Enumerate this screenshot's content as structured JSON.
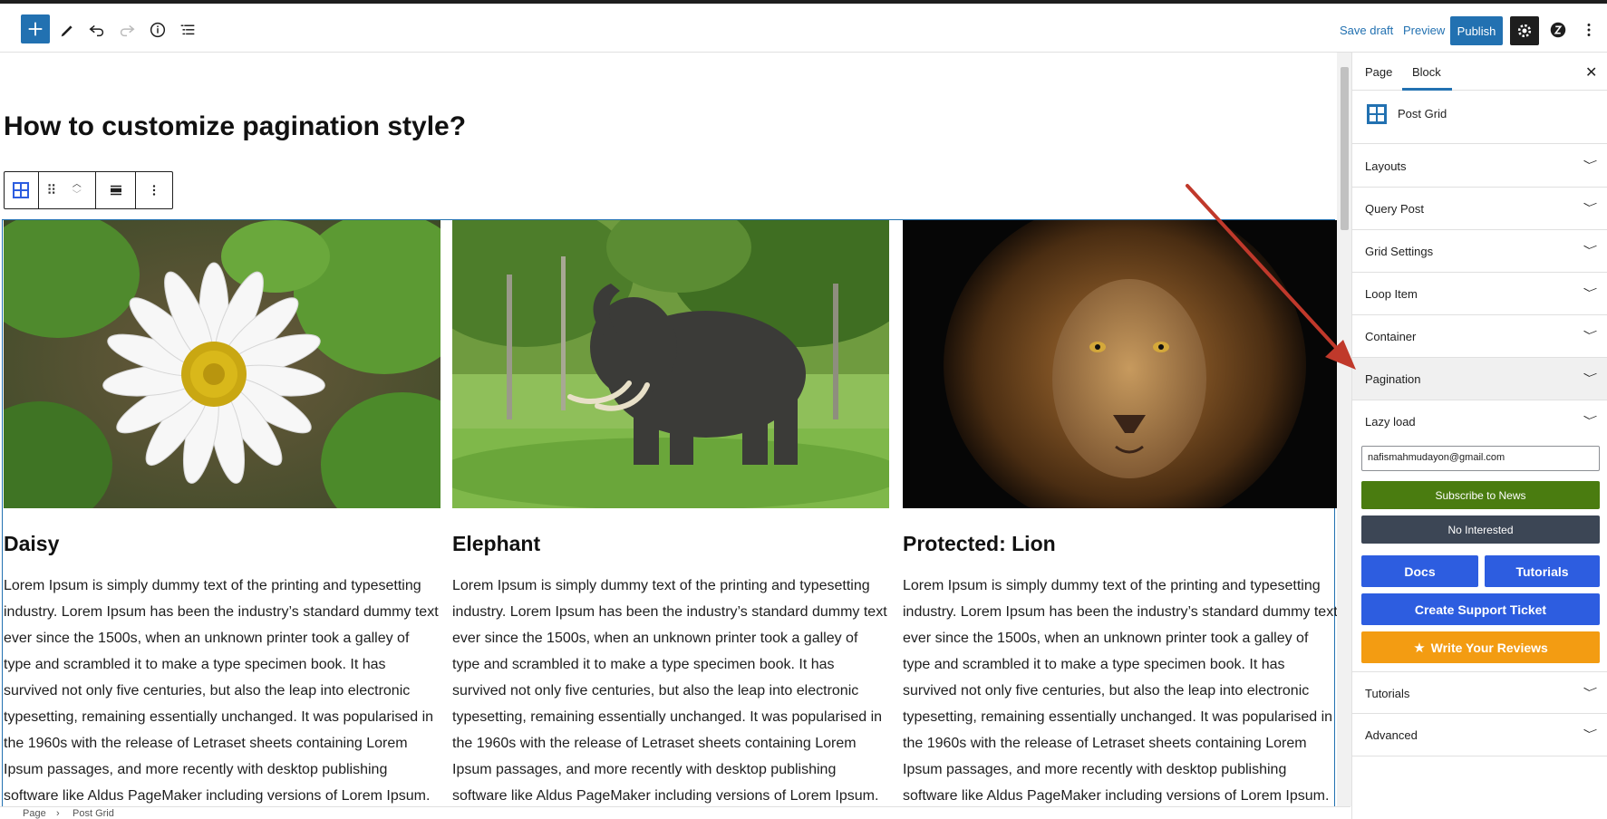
{
  "toolbar": {
    "add_icon": "plus-icon",
    "save_draft": "Save draft",
    "preview": "Preview",
    "publish": "Publish"
  },
  "editor": {
    "title": "How to customize pagination style?",
    "cards": [
      {
        "title": "Daisy",
        "text": "Lorem Ipsum is simply dummy text of the printing and typesetting industry. Lorem Ipsum has been the industry’s standard dummy text ever since the 1500s, when an unknown printer took a galley of type and scrambled it to make a type specimen book. It has survived not only five centuries, but also the leap into electronic typesetting, remaining essentially unchanged. It was popularised in the 1960s with the release of Letraset sheets containing Lorem Ipsum passages, and more recently with desktop publishing software like Aldus PageMaker including versions of Lorem Ipsum."
      },
      {
        "title": "Elephant",
        "text": "Lorem Ipsum is simply dummy text of the printing and typesetting industry. Lorem Ipsum has been the industry’s standard dummy text ever since the 1500s, when an unknown printer took a galley of type and scrambled it to make a type specimen book. It has survived not only five centuries, but also the leap into electronic typesetting, remaining essentially unchanged. It was popularised in the 1960s with the release of Letraset sheets containing Lorem Ipsum passages, and more recently with desktop publishing software like Aldus PageMaker including versions of Lorem Ipsum."
      },
      {
        "title": "Protected: Lion",
        "text": "Lorem Ipsum is simply dummy text of the printing and typesetting industry. Lorem Ipsum has been the industry’s standard dummy text ever since the 1500s, when an unknown printer took a galley of type and scrambled it to make a type specimen book. It has survived not only five centuries, but also the leap into electronic typesetting, remaining essentially unchanged. It was popularised in the 1960s with the release of Letraset sheets containing Lorem Ipsum passages, and more recently with desktop publishing software like Aldus PageMaker including versions of Lorem Ipsum."
      }
    ]
  },
  "breadcrumb": {
    "root": "Page",
    "separator": "›",
    "current": "Post Grid"
  },
  "sidebar": {
    "tabs": [
      "Page",
      "Block"
    ],
    "block_name": "Post Grid",
    "panels": [
      "Layouts",
      "Query Post",
      "Grid Settings",
      "Loop Item",
      "Container",
      "Pagination",
      "Lazy load"
    ],
    "email_value": "nafismahmudayon@gmail.com",
    "subscribe": "Subscribe to News",
    "no_interest": "No Interested",
    "docs": "Docs",
    "tutorials_btn": "Tutorials",
    "support": "Create Support Ticket",
    "reviews": "Write Your Reviews",
    "bottom_panels": [
      "Tutorials",
      "Advanced"
    ]
  },
  "colors": {
    "accent": "#2271b1",
    "annotation_arrow": "#c0392b"
  }
}
